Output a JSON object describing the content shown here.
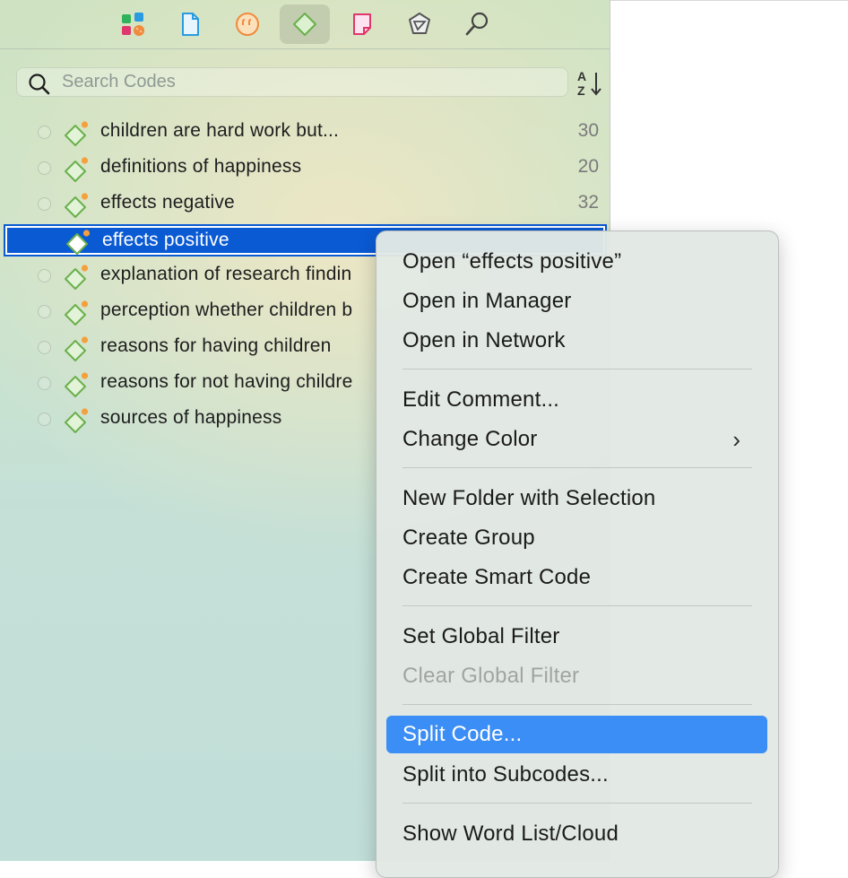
{
  "search": {
    "placeholder": "Search Codes"
  },
  "toolbar": {
    "buttons": [
      "entities-icon",
      "documents-icon",
      "quotations-icon",
      "codes-icon",
      "memos-icon",
      "networks-icon",
      "search-icon"
    ],
    "active": "codes-icon"
  },
  "sort": {
    "icon": "sort-az-icon"
  },
  "codes": [
    {
      "label": "children are hard work but...",
      "count": "30"
    },
    {
      "label": "definitions of happiness",
      "count": "20"
    },
    {
      "label": "effects negative",
      "count": "32"
    },
    {
      "label": "effects positive",
      "count": ""
    },
    {
      "label": "explanation of research findin",
      "count": ""
    },
    {
      "label": "perception whether children b",
      "count": ""
    },
    {
      "label": "reasons for having children",
      "count": ""
    },
    {
      "label": "reasons for not having childre",
      "count": ""
    },
    {
      "label": "sources of happiness",
      "count": ""
    }
  ],
  "context_menu": {
    "open_item": "Open “effects positive”",
    "open_in_manager": "Open in Manager",
    "open_in_network": "Open in Network",
    "edit_comment": "Edit Comment...",
    "change_color": "Change Color",
    "submenu_chevron": "›",
    "new_folder": "New Folder with Selection",
    "create_group": "Create Group",
    "create_smart_code": "Create Smart Code",
    "set_global_filter": "Set Global Filter",
    "clear_global_filter": "Clear Global Filter",
    "split_code": "Split Code...",
    "split_into_subcodes": "Split into Subcodes...",
    "show_word_list": "Show Word List/Cloud"
  },
  "colors": {
    "selection": "#0a5ad4",
    "menu_highlight": "#3b8ef5",
    "code_green": "#6ab04c",
    "comment_orange": "#f5a03a"
  }
}
